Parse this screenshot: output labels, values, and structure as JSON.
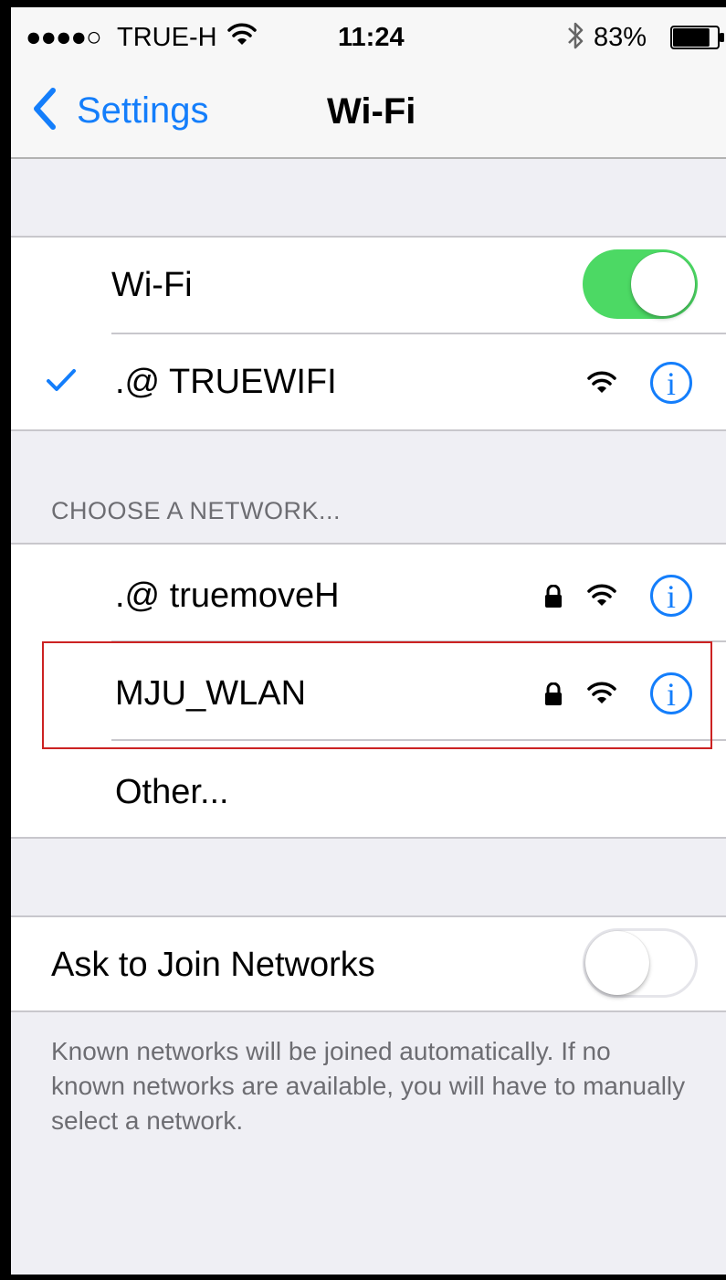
{
  "status_bar": {
    "signal": "●●●●○",
    "carrier": "TRUE-H",
    "time": "11:24",
    "battery_percent": "83%",
    "battery_level": 0.83
  },
  "nav": {
    "back_label": "Settings",
    "title": "Wi-Fi"
  },
  "wifi": {
    "label": "Wi-Fi",
    "enabled": true,
    "connected_network": ".@ TRUEWIFI"
  },
  "choose_section": {
    "header": "CHOOSE A NETWORK...",
    "networks": [
      {
        "name": ".@ truemoveH",
        "locked": true
      },
      {
        "name": "MJU_WLAN",
        "locked": true
      }
    ],
    "other_label": "Other..."
  },
  "ask_to_join": {
    "label": "Ask to Join Networks",
    "enabled": false,
    "footer": "Known networks will be joined automatically. If no known networks are available, you will have to manually select a network."
  },
  "colors": {
    "accent": "#147efb",
    "toggle_on": "#4cd964",
    "highlight": "#cc2222"
  }
}
